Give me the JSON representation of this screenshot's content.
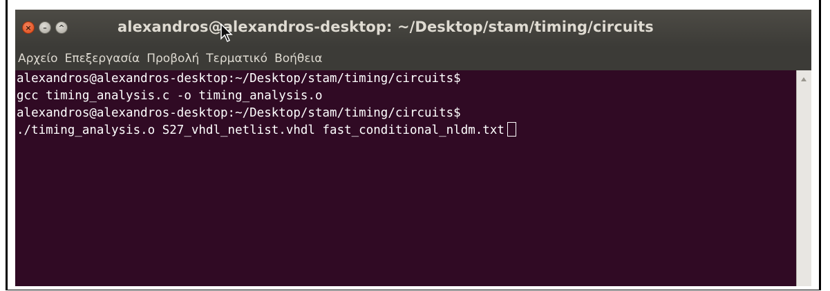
{
  "window": {
    "title": "alexandros@alexandros-desktop: ~/Desktop/stam/timing/circuits",
    "buttons": {
      "close": "×",
      "minimize": "–",
      "maximize": "^"
    }
  },
  "menubar": {
    "items": [
      "Αρχείο",
      "Επεξεργασία",
      "Προβολή",
      "Τερματικό",
      "Βοήθεια"
    ]
  },
  "terminal": {
    "lines": [
      "alexandros@alexandros-desktop:~/Desktop/stam/timing/circuits$",
      "gcc timing_analysis.c -o timing_analysis.o",
      "alexandros@alexandros-desktop:~/Desktop/stam/timing/circuits$",
      "./timing_analysis.o S27_vhdl_netlist.vhdl fast_conditional_nldm.txt"
    ],
    "background": "#300a24",
    "foreground": "#ffffff"
  },
  "colors": {
    "titlebar": "#3c3b37",
    "close_button": "#dd4814"
  }
}
